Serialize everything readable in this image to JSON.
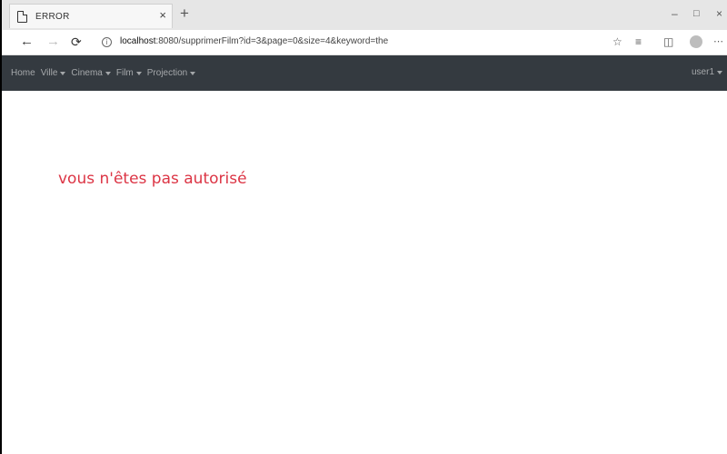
{
  "browser": {
    "tab_title": "ERROR",
    "tab_close": "×",
    "new_tab": "+",
    "window_controls": {
      "minimize": "–",
      "maximize": "□",
      "close": "×"
    },
    "url_host": "localhost",
    "url_rest": ":8080/supprimerFilm?id=3&page=0&size=4&keyword=the",
    "icons": [
      "document-icon",
      "back-icon",
      "forward-icon",
      "refresh-icon",
      "info-icon",
      "star-icon",
      "favorites-icon",
      "collections-icon",
      "profile-icon",
      "more-icon"
    ]
  },
  "navbar": {
    "items": [
      {
        "label": "Home",
        "dropdown": false
      },
      {
        "label": "Ville",
        "dropdown": true
      },
      {
        "label": "Cinema",
        "dropdown": true
      },
      {
        "label": "Film",
        "dropdown": true
      },
      {
        "label": "Projection",
        "dropdown": true
      }
    ],
    "user": "user1",
    "background": "#343a40"
  },
  "content": {
    "error_message": "vous n'êtes pas autorisé",
    "error_color": "#dc3545"
  }
}
